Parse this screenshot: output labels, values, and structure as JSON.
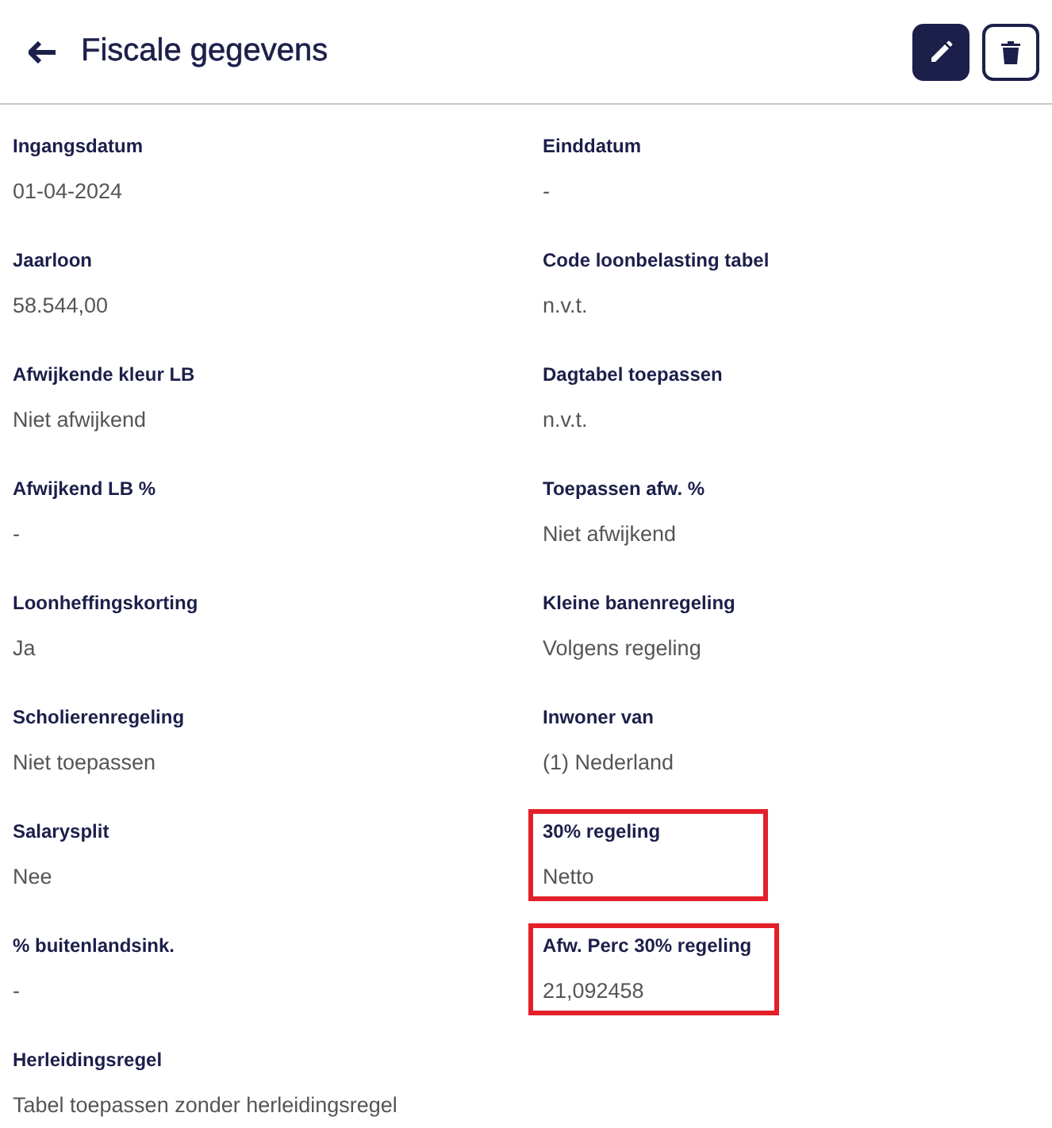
{
  "header": {
    "title": "Fiscale gegevens"
  },
  "fields": [
    {
      "label": "Ingangsdatum",
      "value": "01-04-2024",
      "highlighted": false
    },
    {
      "label": "Einddatum",
      "value": "-",
      "highlighted": false
    },
    {
      "label": "Jaarloon",
      "value": "58.544,00",
      "highlighted": false
    },
    {
      "label": "Code loonbelasting tabel",
      "value": "n.v.t.",
      "highlighted": false
    },
    {
      "label": "Afwijkende kleur LB",
      "value": "Niet afwijkend",
      "highlighted": false
    },
    {
      "label": "Dagtabel toepassen",
      "value": "n.v.t.",
      "highlighted": false
    },
    {
      "label": "Afwijkend LB %",
      "value": "-",
      "highlighted": false
    },
    {
      "label": "Toepassen afw. %",
      "value": "Niet afwijkend",
      "highlighted": false
    },
    {
      "label": "Loonheffingskorting",
      "value": "Ja",
      "highlighted": false
    },
    {
      "label": "Kleine banenregeling",
      "value": "Volgens regeling",
      "highlighted": false
    },
    {
      "label": "Scholierenregeling",
      "value": "Niet toepassen",
      "highlighted": false
    },
    {
      "label": "Inwoner van",
      "value": "(1) Nederland",
      "highlighted": false
    },
    {
      "label": "Salarysplit",
      "value": "Nee",
      "highlighted": false
    },
    {
      "label": "30% regeling",
      "value": "Netto",
      "highlighted": true
    },
    {
      "label": "% buitenlandsink.",
      "value": "-",
      "highlighted": false
    },
    {
      "label": "Afw. Perc 30% regeling",
      "value": "21,092458",
      "highlighted": true
    },
    {
      "label": "Herleidingsregel",
      "value": "Tabel toepassen zonder herleidingsregel",
      "highlighted": false
    }
  ]
}
